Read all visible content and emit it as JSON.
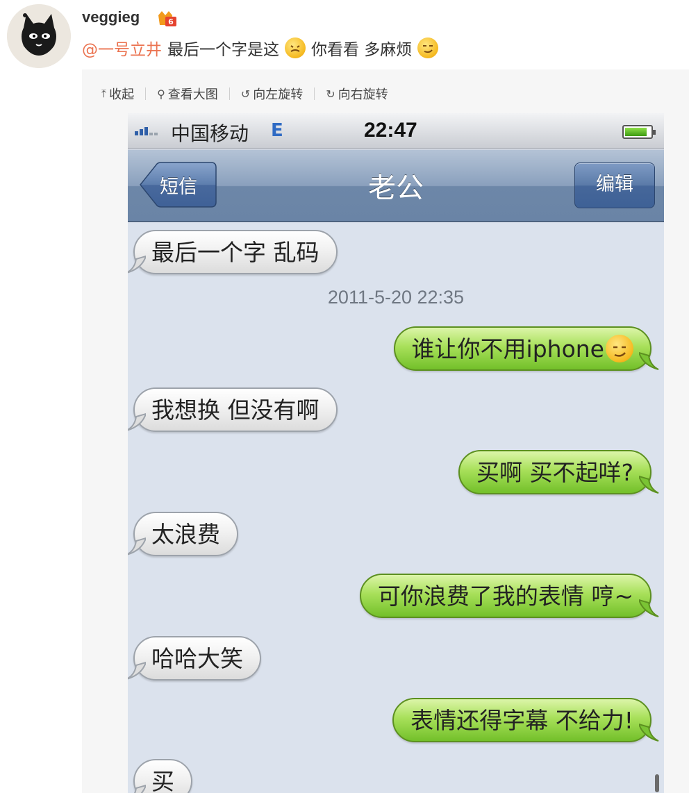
{
  "post": {
    "username": "veggieg",
    "mention": "@一号立井",
    "text_before_emoji": "最后一个字是这",
    "text_after_emoji_1": "你看看 多麻烦",
    "avatar_icon": "black-cat-avatar",
    "badge_icon": "vip-badge-icon"
  },
  "viewer": {
    "collapse_label": "收起",
    "view_large_label": "查看大图",
    "rotate_left_label": "向左旋转",
    "rotate_right_label": "向右旋转"
  },
  "phone": {
    "status": {
      "carrier": "中国移动",
      "network": "E",
      "time": "22:47",
      "battery_level": 0.85
    },
    "nav": {
      "back_label": "短信",
      "title": "老公",
      "edit_label": "编辑"
    },
    "timestamp": "2011-5-20 22:35",
    "messages": [
      {
        "dir": "in",
        "text": "最后一个字 乱码"
      },
      {
        "dir": "out",
        "text": "谁让你不用iphone",
        "emoji": "smirk-emoji"
      },
      {
        "dir": "in",
        "text": "我想换 但没有啊"
      },
      {
        "dir": "out",
        "text": "买啊 买不起咩?"
      },
      {
        "dir": "in",
        "text": "太浪费"
      },
      {
        "dir": "out",
        "text": "可你浪费了我的表情 哼~"
      },
      {
        "dir": "in",
        "text": "哈哈大笑"
      },
      {
        "dir": "out",
        "text": "表情还得字幕 不给力!"
      },
      {
        "dir": "in",
        "text": "买"
      }
    ]
  },
  "colors": {
    "mention": "#eb7350",
    "incoming_bubble": "#f1f1f1",
    "outgoing_bubble": "#a8e05a",
    "navbar": "#6d87a8"
  }
}
